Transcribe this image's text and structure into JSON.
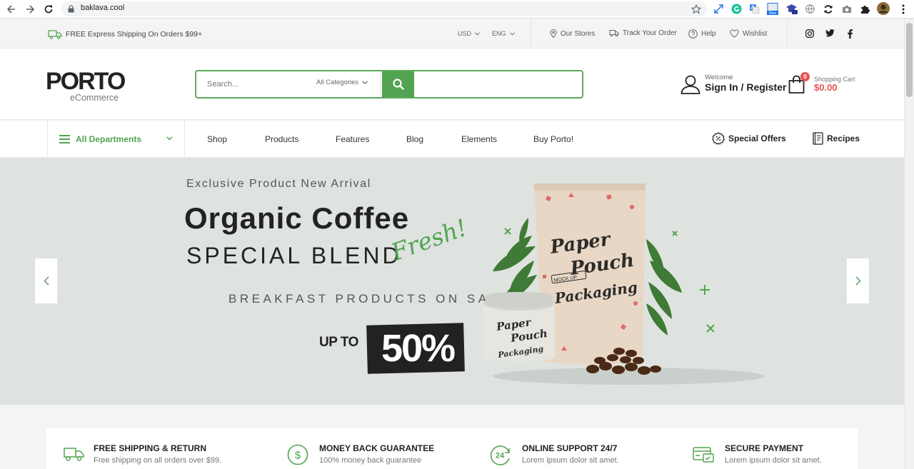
{
  "browser": {
    "url": "baklava.cool"
  },
  "topbar": {
    "shipping_text": "FREE Express Shipping On Orders $99+",
    "currency": "USD",
    "language": "ENG",
    "links": [
      "Our Stores",
      "Track Your Order",
      "Help",
      "Wishlist"
    ]
  },
  "header": {
    "logo_main": "PORTO",
    "logo_sub": "eCommerce",
    "search_placeholder": "Search...",
    "search_category": "All Categories",
    "welcome": "Welcome",
    "signin": "Sign In / Register",
    "cart_count": "0",
    "cart_label": "Shopping Cart",
    "cart_total": "$0.00"
  },
  "nav": {
    "departments": "All Departments",
    "links": [
      "Shop",
      "Products",
      "Features",
      "Blog",
      "Elements",
      "Buy Porto!"
    ],
    "special_offers": "Special Offers",
    "recipes": "Recipes"
  },
  "hero": {
    "kicker": "Exclusive Product New Arrival",
    "title": "Organic Coffee",
    "subtitle": "SPECIAL BLEND",
    "script": "Fresh!",
    "sale": "BREAKFAST PRODUCTS ON SALE",
    "upto": "UP TO",
    "percent": "50%",
    "pouch_line1": "Paper",
    "pouch_line2": "Pouch",
    "pouch_line3": "Packaging",
    "pouch_mockup": "MOCK UP",
    "tin_line1": "Paper",
    "tin_line2": "Pouch",
    "tin_line3": "Packaging"
  },
  "features": [
    {
      "title": "FREE SHIPPING & RETURN",
      "sub": "Free shipping on all orders over $99."
    },
    {
      "title": "MONEY BACK GUARANTEE",
      "sub": "100% money back guarantee"
    },
    {
      "title": "ONLINE SUPPORT 24/7",
      "sub": "Lorem ipsum dolor sit amet."
    },
    {
      "title": "SECURE PAYMENT",
      "sub": "Lorem ipsum dolor sit amet."
    }
  ],
  "colors": {
    "accent_green": "#52a452",
    "cart_red": "#e55454",
    "hero_bg": "#dee3df"
  }
}
